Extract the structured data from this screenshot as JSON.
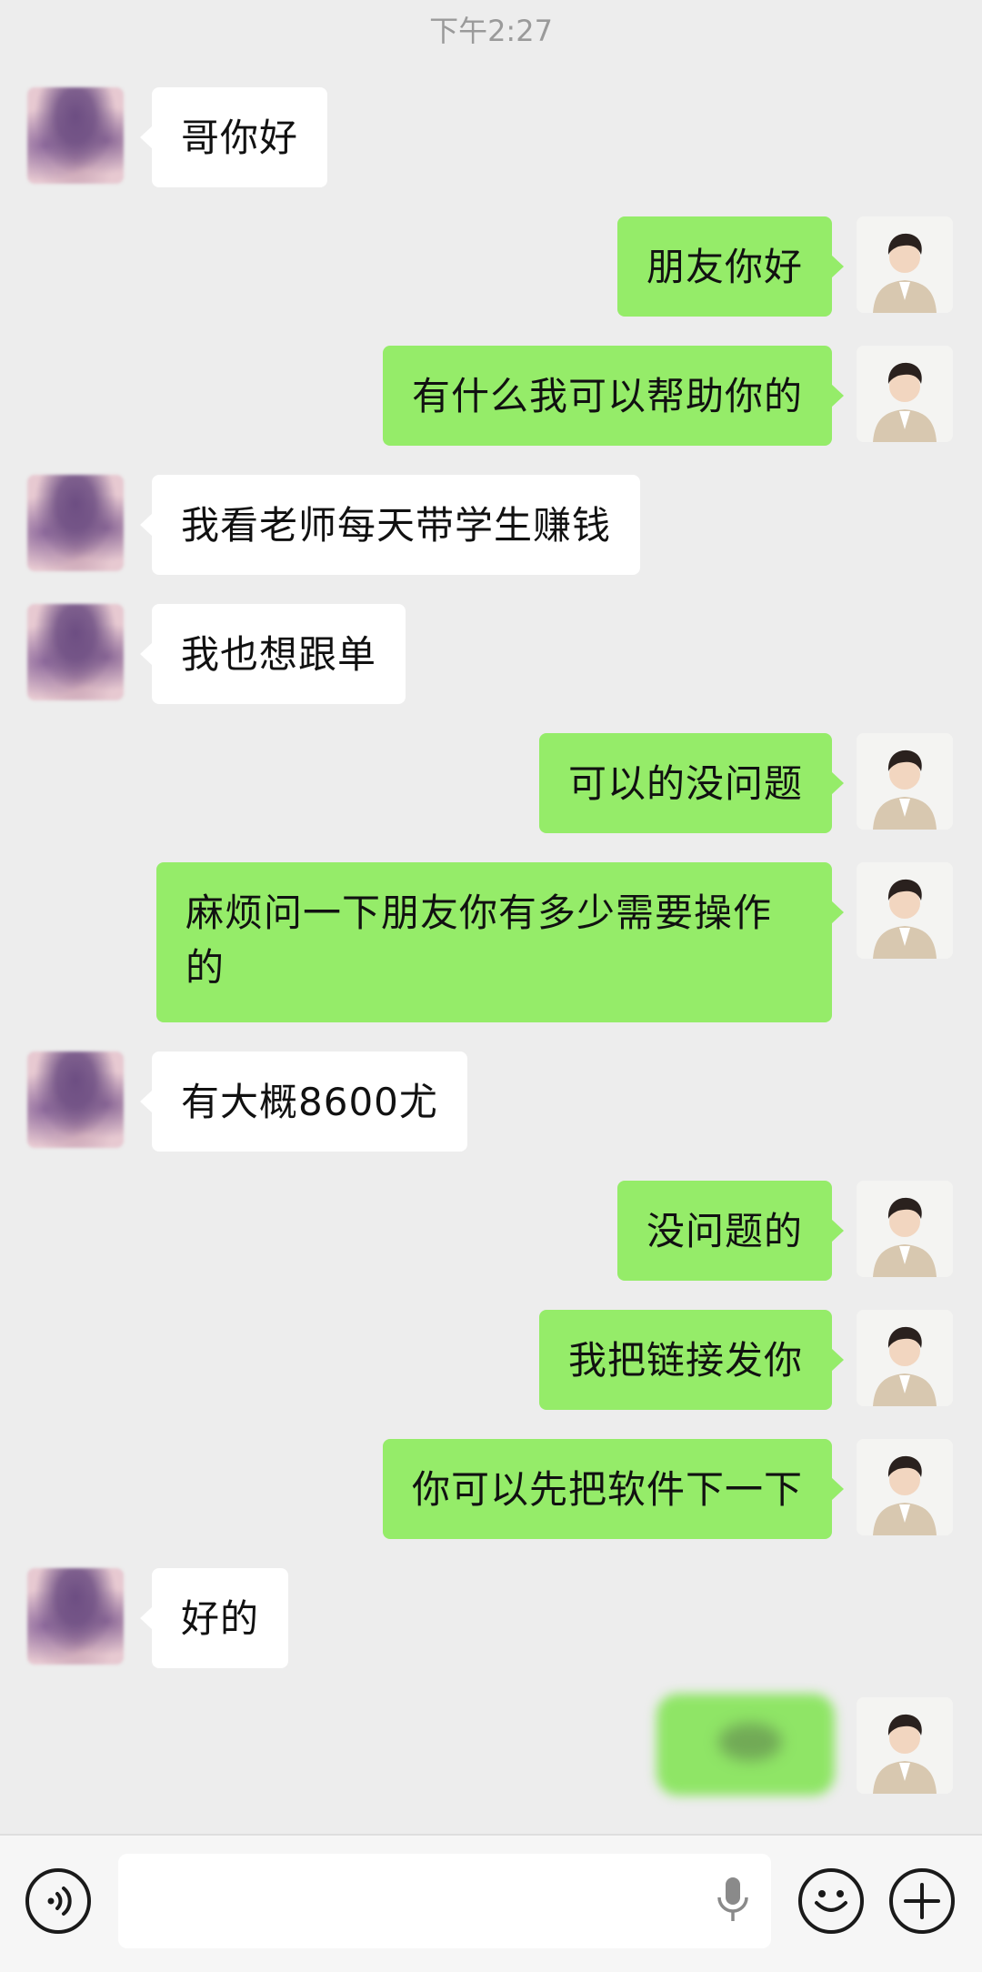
{
  "status": {
    "time": "下午2:27"
  },
  "colors": {
    "outgoing_bubble": "#95ec69",
    "incoming_bubble": "#ffffff",
    "background": "#ededed"
  },
  "messages": [
    {
      "side": "in",
      "text": "哥你好"
    },
    {
      "side": "out",
      "text": "朋友你好"
    },
    {
      "side": "out",
      "text": "有什么我可以帮助你的"
    },
    {
      "side": "in",
      "text": "我看老师每天带学生赚钱"
    },
    {
      "side": "in",
      "text": "我也想跟单"
    },
    {
      "side": "out",
      "text": "可以的没问题"
    },
    {
      "side": "out",
      "text": "麻烦问一下朋友你有多少需要操作的"
    },
    {
      "side": "in",
      "text": "有大概8600尤"
    },
    {
      "side": "out",
      "text": "没问题的"
    },
    {
      "side": "out",
      "text": "我把链接发你"
    },
    {
      "side": "out",
      "text": "你可以先把软件下一下"
    },
    {
      "side": "in",
      "text": "好的"
    },
    {
      "side": "out",
      "text": ""
    }
  ],
  "bottom_bar": {
    "voice_icon": "voice-mode-icon",
    "mic_icon": "microphone-icon",
    "emoji_icon": "emoji-icon",
    "plus_icon": "plus-icon"
  }
}
